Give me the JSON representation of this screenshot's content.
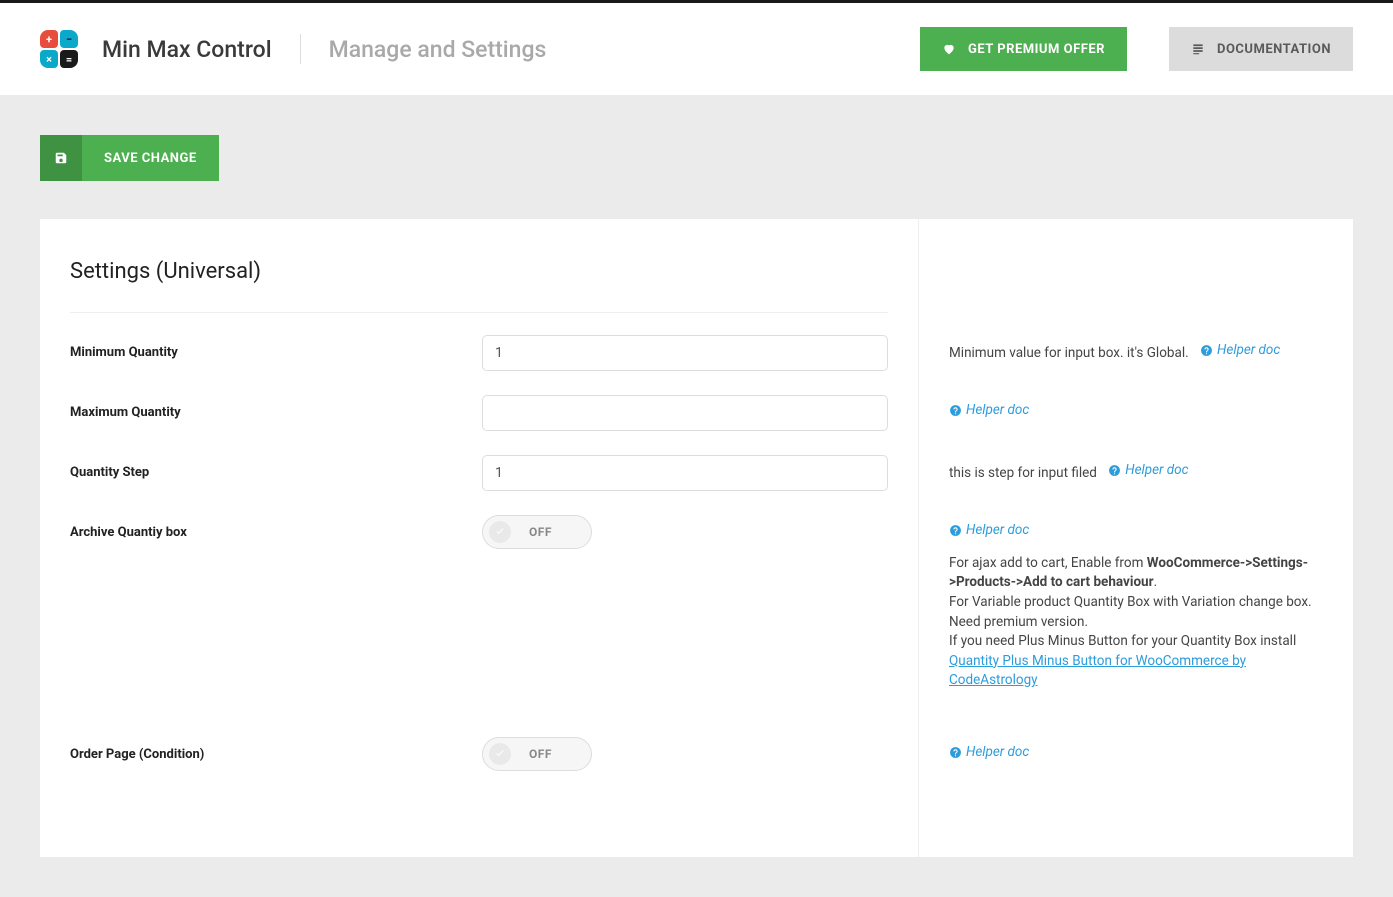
{
  "header": {
    "app_title": "Min Max Control",
    "page_title": "Manage and Settings",
    "premium_label": "GET PREMIUM OFFER",
    "doc_label": "DOCUMENTATION"
  },
  "actions": {
    "save_label": "SAVE CHANGE"
  },
  "section": {
    "title": "Settings (Universal)"
  },
  "settings": {
    "min_qty": {
      "label": "Minimum Quantity",
      "value": "1"
    },
    "max_qty": {
      "label": "Maximum Quantity",
      "value": ""
    },
    "qty_step": {
      "label": "Quantity Step",
      "value": "1"
    },
    "archive_box": {
      "label": "Archive Quantiy box",
      "state": "OFF"
    },
    "order_page": {
      "label": "Order Page (Condition)",
      "state": "OFF"
    }
  },
  "help": {
    "helper_doc": "Helper doc",
    "min_qty_text": "Minimum value for input box. it's Global.",
    "qty_step_text": "this is step for input filed",
    "archive": {
      "line1_prefix": "For ajax add to cart, Enable from ",
      "line1_bold": "WooCommerce->Settings->Products->Add to cart behaviour",
      "line2": "For Variable product Quantity Box with Variation change box. Need premium version.",
      "line3_prefix": "If you need Plus Minus Button for your Quantity Box install ",
      "line3_link": "Quantity Plus Minus Button for WooCommerce by CodeAstrology"
    }
  }
}
